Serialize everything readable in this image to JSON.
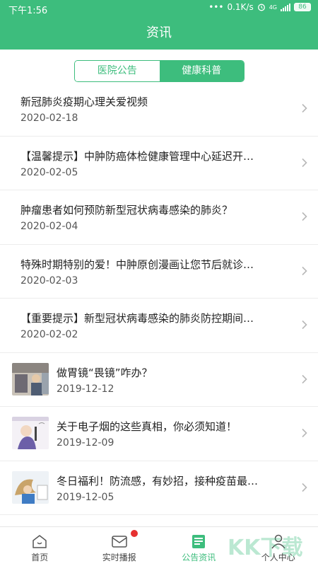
{
  "status_bar": {
    "time": "下午1:56",
    "dots": "•••",
    "speed": "0.1K/s",
    "network": "4G",
    "battery": "86"
  },
  "header": {
    "title": "资讯"
  },
  "tabs": [
    {
      "label": "医院公告",
      "active": false
    },
    {
      "label": "健康科普",
      "active": true
    }
  ],
  "articles": [
    {
      "title": "新冠肺炎疫期心理关爱视频",
      "date": "2020-02-18"
    },
    {
      "title": "【温馨提示】中肿防癌体检健康管理中心延迟开…",
      "date": "2020-02-05"
    },
    {
      "title": "肿瘤患者如何预防新型冠状病毒感染的肺炎？",
      "date": "2020-02-04"
    },
    {
      "title": "特殊时期特别的爱！中肿原创漫画让您节后就诊…",
      "date": "2020-02-03"
    },
    {
      "title": "【重要提示】新型冠状病毒感染的肺炎防控期间…",
      "date": "2020-02-02"
    },
    {
      "title": "做胃镜“畏镜”咋办？",
      "date": "2019-12-12"
    },
    {
      "title": "关于电子烟的这些真相，你必须知道！",
      "date": "2019-12-09"
    },
    {
      "title": "冬日福利！防流感，有妙招，接种疫苗最…",
      "date": "2019-12-05"
    }
  ],
  "tabbar": [
    {
      "label": "首页",
      "icon": "home-icon"
    },
    {
      "label": "实时播报",
      "icon": "message-icon"
    },
    {
      "label": "公告资讯",
      "icon": "news-icon",
      "active": true
    },
    {
      "label": "个人中心",
      "icon": "person-icon"
    }
  ],
  "colors": {
    "brand": "#3dbd7d",
    "badge": "#e63030"
  }
}
